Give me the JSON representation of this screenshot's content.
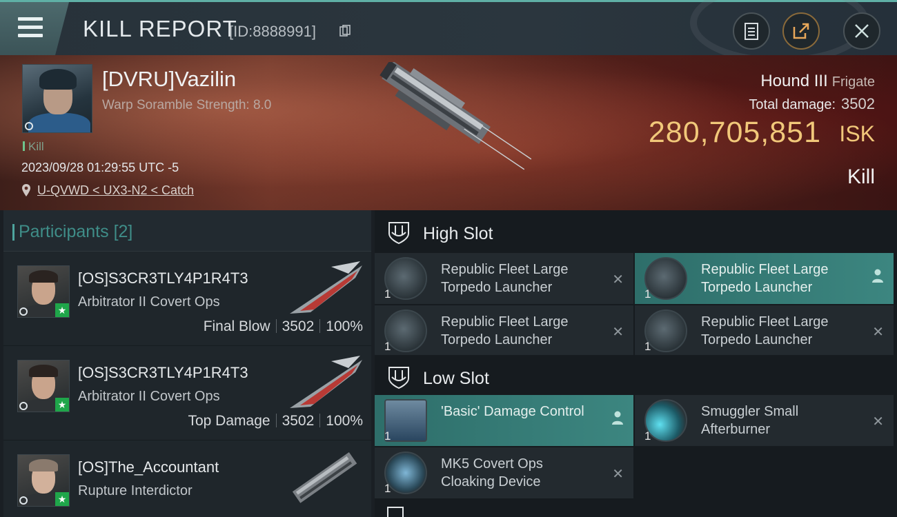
{
  "header": {
    "title": "KILL REPORT",
    "report_id": "[ID:8888991]"
  },
  "victim": {
    "pilot_name": "[DVRU]Vazilin",
    "warp_scramble": "Warp Soramble Strength: 8.0",
    "kill_tag": "Kill",
    "datetime": "2023/09/28 01:29:55 UTC -5",
    "location": "U-QVWD < UX3-N2 < Catch",
    "ship_name": "Hound III",
    "ship_class": "Frigate",
    "total_damage_label": "Total damage:",
    "total_damage_value": "3502",
    "isk_value": "280,705,851",
    "isk_unit": "ISK",
    "result": "Kill"
  },
  "participants": {
    "title": "Participants",
    "count": "[2]",
    "rows": [
      {
        "name": "[OS]S3CR3TLY4P1R4T3",
        "ship": "Arbitrator II Covert Ops",
        "role": "Final Blow",
        "damage": "3502",
        "percent": "100%"
      },
      {
        "name": "[OS]S3CR3TLY4P1R4T3",
        "ship": "Arbitrator II Covert Ops",
        "role": "Top Damage",
        "damage": "3502",
        "percent": "100%"
      },
      {
        "name": "[OS]The_Accountant",
        "ship": "Rupture Interdictor"
      }
    ]
  },
  "fitting": {
    "high_slot_label": "High Slot",
    "low_slot_label": "Low Slot",
    "high": [
      {
        "name": "Republic Fleet Large Torpedo Launcher",
        "qty": "1",
        "status": "destroyed"
      },
      {
        "name": "Republic Fleet Large Torpedo Launcher",
        "qty": "1",
        "status": "dropped"
      },
      {
        "name": "Republic Fleet Large Torpedo Launcher",
        "qty": "1",
        "status": "destroyed"
      },
      {
        "name": "Republic Fleet Large Torpedo Launcher",
        "qty": "1",
        "status": "destroyed"
      }
    ],
    "low": [
      {
        "name": "'Basic' Damage Control",
        "qty": "1",
        "status": "dropped"
      },
      {
        "name": "Smuggler Small Afterburner",
        "qty": "1",
        "status": "destroyed"
      },
      {
        "name": "MK5 Covert Ops Cloaking Device",
        "qty": "1",
        "status": "destroyed"
      }
    ]
  }
}
